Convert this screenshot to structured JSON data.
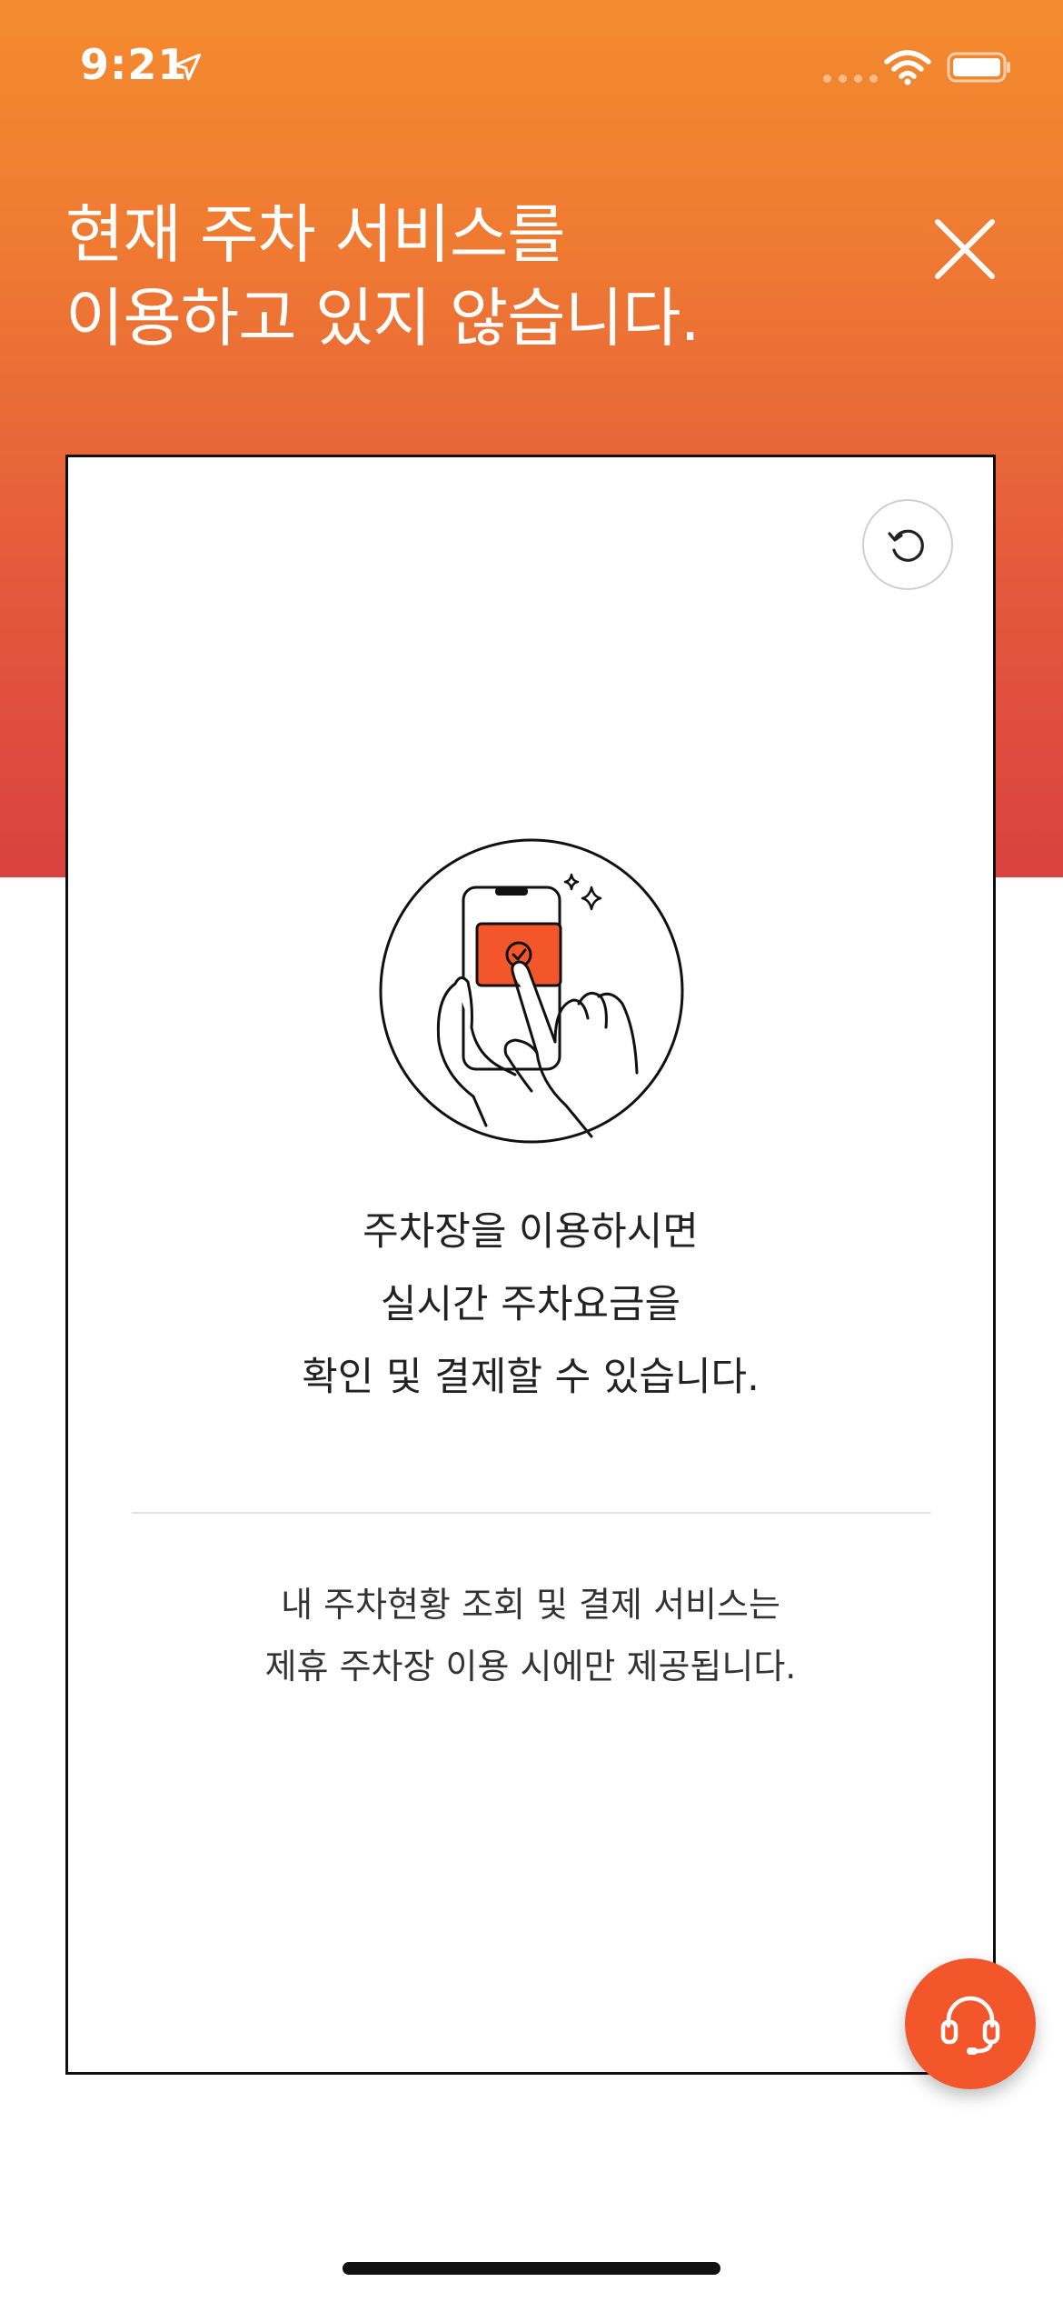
{
  "status_bar": {
    "time": "9:21",
    "location_icon": "location-arrow-icon",
    "wifi_icon": "wifi-icon",
    "battery_icon": "battery-icon"
  },
  "header": {
    "title_line1": "현재 주차 서비스를",
    "title_line2": "이용하고 있지 않습니다.",
    "close_icon": "close-icon"
  },
  "card": {
    "refresh_icon": "refresh-icon",
    "illustration": "phone-payment-illustration",
    "message_lines": [
      "주차장을 이용하시면",
      "실시간 주차요금을",
      "확인 및 결제할 수 있습니다."
    ],
    "notice_lines": [
      "내 주차현황 조회 및 결제 서비스는",
      "제휴 주차장 이용 시에만 제공됩니다."
    ]
  },
  "support_button": {
    "icon": "headset-icon"
  },
  "colors": {
    "gradient_top": "#f48b2e",
    "gradient_bottom": "#d9423f",
    "accent": "#f4562b",
    "card_border": "#111111"
  }
}
